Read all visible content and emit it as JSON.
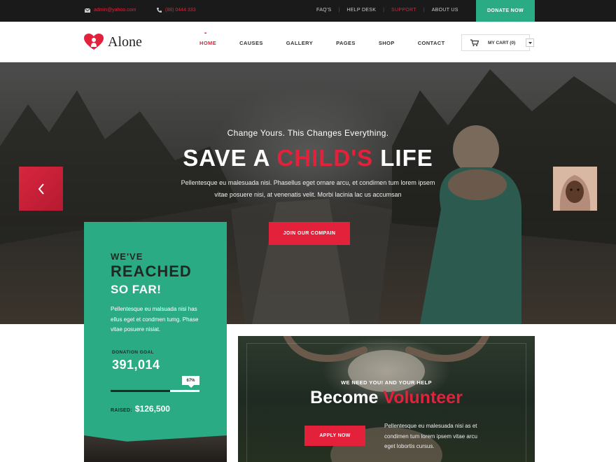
{
  "topbar": {
    "email": "admin@yahoo.com",
    "phone": "(88) 0444 333",
    "links": [
      "FAQ'S",
      "HELP DESK",
      "SUPPORT",
      "ABOUT US"
    ],
    "active_link": "SUPPORT",
    "donate_label": "DONATE NOW"
  },
  "header": {
    "logo_text": "Alone",
    "nav": [
      "HOME",
      "CAUSES",
      "GALLERY",
      "PAGES",
      "SHOP",
      "CONTACT"
    ],
    "active_nav": "HOME",
    "cart_label": "MY CART (0)"
  },
  "hero": {
    "tagline": "Change Yours. This Changes Everything.",
    "title_part1": "SAVE A ",
    "title_highlight": "CHILD'S",
    "title_part2": " LIFE",
    "description": "Pellentesque eu malesuada nisi. Phasellus eget ornare arcu, et condimen tum lorem ipsem vitae posuere nisi, at venenatis velit. Morbi lacinia lac us accumsan",
    "cta_label": "JOIN OUR COMPAIN"
  },
  "reached": {
    "line1": "WE'VE",
    "line2": "REACHED",
    "line3": "SO FAR!",
    "description": "Pellentesque eu malsuada nisi has ellus eget et condmen tumg. Phase vitae posuere nisiat.",
    "goal_label": "DONATION GOAL",
    "goal_value": "391,014",
    "progress_percent": 67,
    "progress_label": "67%",
    "raised_label": "RAISED:",
    "raised_value": "$126,500"
  },
  "volunteer": {
    "tagline": "WE NEED YOU! AND YOUR HELP",
    "title_part1": "Become ",
    "title_highlight": "Volunteer",
    "cta_label": "APPLY NOW",
    "description": "Pellentesque eu malesuada nisi as et condimen tum lorem ipsem vitae arcu eget lobortis cursus."
  },
  "colors": {
    "accent_red": "#e3213b",
    "accent_green": "#2bab83",
    "topbar_bg": "#1a1a1a"
  },
  "icons": [
    "mail-icon",
    "phone-icon",
    "heart-logo-icon",
    "cart-icon",
    "caret-down-icon",
    "chevron-left-icon"
  ]
}
